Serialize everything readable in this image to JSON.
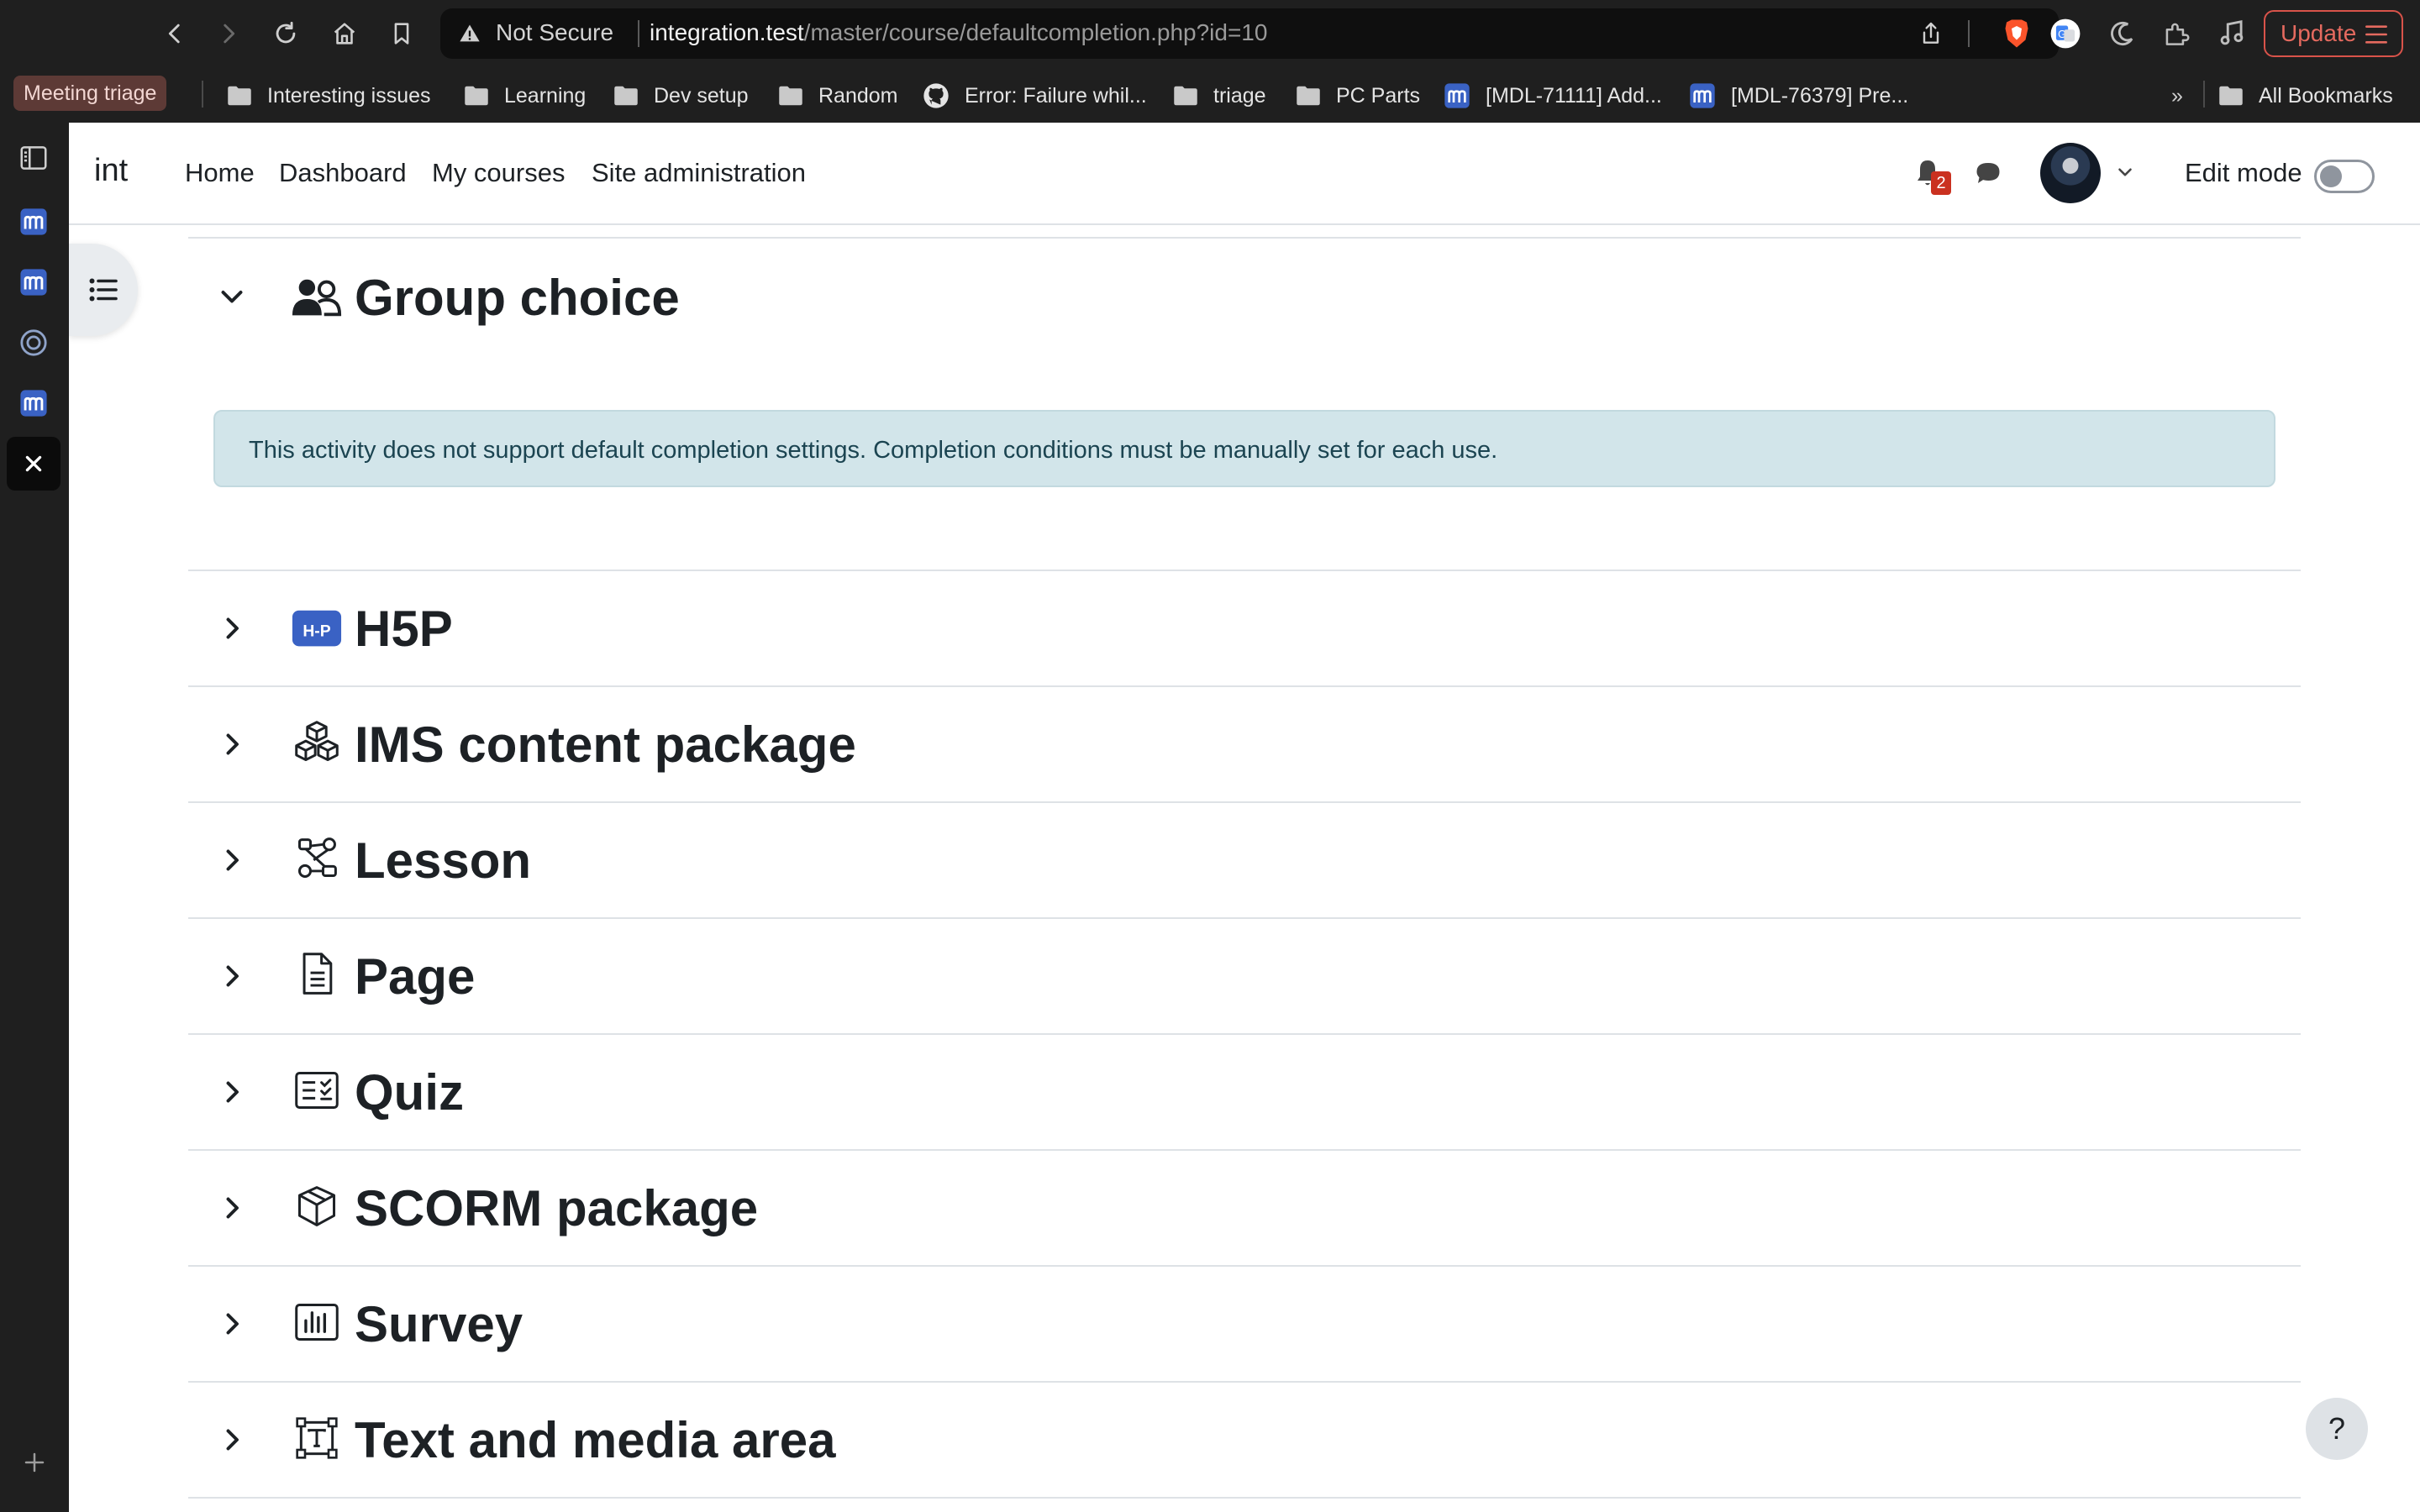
{
  "browser": {
    "security_label": "Not Secure",
    "url_host": "integration.test",
    "url_path": "/master/course/defaultcompletion.php?id=10",
    "update_label": "Update",
    "bookmarks": [
      {
        "label": "Meeting triage",
        "icon": "none"
      },
      {
        "label": "Interesting issues",
        "icon": "folder-icon"
      },
      {
        "label": "Learning",
        "icon": "folder-icon"
      },
      {
        "label": "Dev setup",
        "icon": "folder-icon"
      },
      {
        "label": "Random",
        "icon": "folder-icon"
      },
      {
        "label": "Error: Failure whil...",
        "icon": "github-icon"
      },
      {
        "label": "triage",
        "icon": "folder-icon"
      },
      {
        "label": "PC Parts",
        "icon": "folder-icon"
      },
      {
        "label": "[MDL-71111] Add...",
        "icon": "moodle-tracker-icon"
      },
      {
        "label": "[MDL-76379] Pre...",
        "icon": "moodle-tracker-icon"
      }
    ],
    "overflow_label": "»",
    "all_bookmarks_label": "All Bookmarks"
  },
  "navbar": {
    "brand": "int",
    "links": [
      "Home",
      "Dashboard",
      "My courses",
      "Site administration"
    ],
    "notification_count": "2",
    "edit_mode_label": "Edit mode"
  },
  "sections": [
    {
      "title": "Group choice",
      "expanded": true,
      "icon": "group-icon"
    },
    {
      "title": "H5P",
      "expanded": false,
      "icon": "h5p-icon"
    },
    {
      "title": "IMS content package",
      "expanded": false,
      "icon": "ims-package-icon"
    },
    {
      "title": "Lesson",
      "expanded": false,
      "icon": "lesson-icon"
    },
    {
      "title": "Page",
      "expanded": false,
      "icon": "page-icon"
    },
    {
      "title": "Quiz",
      "expanded": false,
      "icon": "quiz-icon"
    },
    {
      "title": "SCORM package",
      "expanded": false,
      "icon": "scorm-icon"
    },
    {
      "title": "Survey",
      "expanded": false,
      "icon": "survey-icon"
    },
    {
      "title": "Text and media area",
      "expanded": false,
      "icon": "text-media-icon"
    }
  ],
  "alert": {
    "text": "This activity does not support default completion settings. Completion conditions must be manually set for each use."
  },
  "h5p_icon_text": "H-P",
  "help_label": "?",
  "colors": {
    "alert_bg": "#d2e5ea",
    "alert_text": "#1b4451",
    "badge": "#ca3120",
    "update": "#e56a5f"
  }
}
